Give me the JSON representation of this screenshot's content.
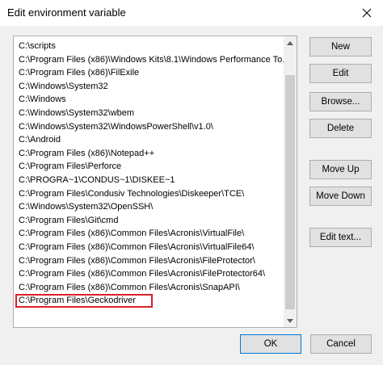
{
  "window": {
    "title": "Edit environment variable"
  },
  "icons": {
    "close": "close-icon",
    "scroll_up": "scroll-up-arrow-icon",
    "scroll_down": "scroll-down-arrow-icon"
  },
  "paths": [
    "C:\\scripts",
    "C:\\Program Files (x86)\\Windows Kits\\8.1\\Windows Performance To...",
    "C:\\Program Files (x86)\\FilExile",
    "C:\\Windows\\System32",
    "C:\\Windows",
    "C:\\Windows\\System32\\wbem",
    "C:\\Windows\\System32\\WindowsPowerShell\\v1.0\\",
    "C:\\Android",
    "C:\\Program Files (x86)\\Notepad++",
    "C:\\Program Files\\Perforce",
    "C:\\PROGRA~1\\CONDUS~1\\DISKEE~1",
    "C:\\Program Files\\Condusiv Technologies\\Diskeeper\\TCE\\",
    "C:\\Windows\\System32\\OpenSSH\\",
    "C:\\Program Files\\Git\\cmd",
    "C:\\Program Files (x86)\\Common Files\\Acronis\\VirtualFile\\",
    "C:\\Program Files (x86)\\Common Files\\Acronis\\VirtualFile64\\",
    "C:\\Program Files (x86)\\Common Files\\Acronis\\FileProtector\\",
    "C:\\Program Files (x86)\\Common Files\\Acronis\\FileProtector64\\",
    "C:\\Program Files (x86)\\Common Files\\Acronis\\SnapAPI\\",
    "C:\\Program Files\\Geckodriver"
  ],
  "selected_index": 19,
  "buttons": {
    "new": "New",
    "edit": "Edit",
    "browse": "Browse...",
    "delete": "Delete",
    "move_up": "Move Up",
    "move_down": "Move Down",
    "edit_text": "Edit text...",
    "ok": "OK",
    "cancel": "Cancel"
  },
  "colors": {
    "highlight_border": "#d9202a",
    "default_button_border": "#0078d7"
  }
}
